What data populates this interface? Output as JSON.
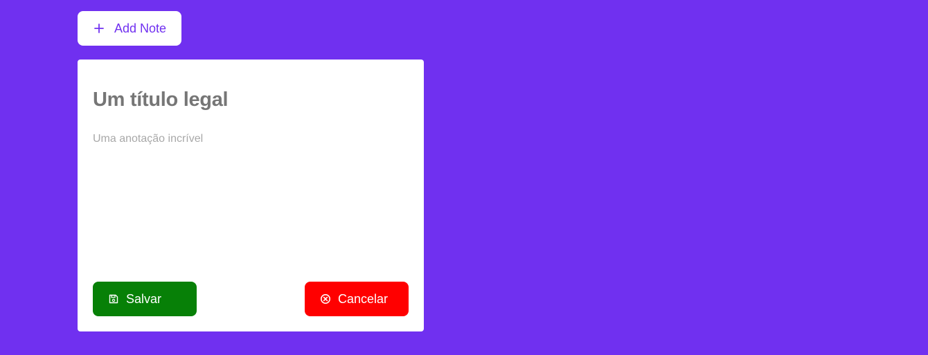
{
  "add_note": {
    "label": "Add Note",
    "icon": "plus-icon"
  },
  "note": {
    "title": "Um título legal",
    "body": "Uma anotação incrível"
  },
  "actions": {
    "save_label": "Salvar",
    "save_icon": "save-icon",
    "cancel_label": "Cancelar",
    "cancel_icon": "close-circle-icon"
  },
  "colors": {
    "background": "#7030f0",
    "save": "#078007",
    "cancel": "#ff0000",
    "accent": "#7030f0"
  }
}
